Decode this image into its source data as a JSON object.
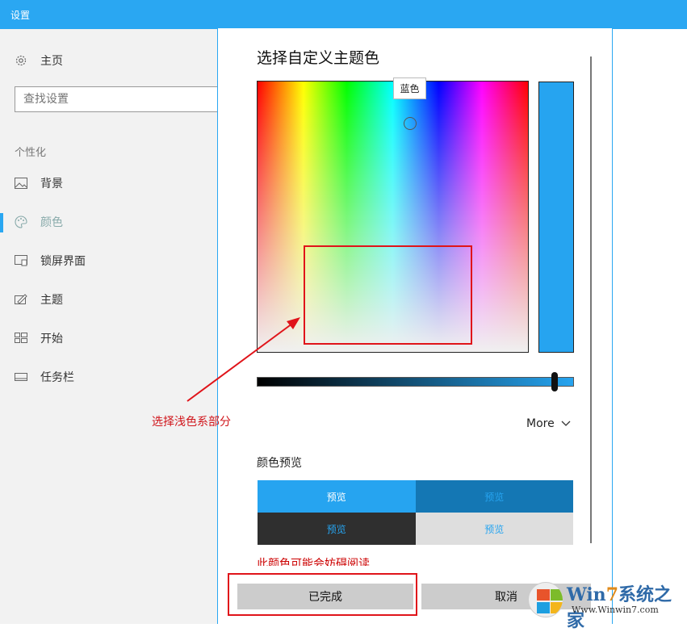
{
  "window": {
    "title": "设置"
  },
  "sidebar": {
    "home": "主页",
    "search_placeholder": "查找设置",
    "section": "个性化",
    "items": [
      {
        "label": "背景",
        "icon": "picture-icon"
      },
      {
        "label": "颜色",
        "icon": "palette-icon",
        "active": true
      },
      {
        "label": "锁屏界面",
        "icon": "lockscreen-icon"
      },
      {
        "label": "主题",
        "icon": "theme-icon"
      },
      {
        "label": "开始",
        "icon": "start-icon"
      },
      {
        "label": "任务栏",
        "icon": "taskbar-icon"
      }
    ]
  },
  "dialog": {
    "title": "选择自定义主题色",
    "tooltip": "蓝色",
    "selected_color": "#26a4f0",
    "more_label": "More",
    "preview_label": "颜色预览",
    "preview_cells": [
      "预览",
      "预览",
      "预览",
      "预览"
    ],
    "preview_colors": [
      "#26a4f0",
      "#1477b4",
      "#2f2f2f",
      "#dedede"
    ],
    "warning": "此颜色可能会妨碍阅读",
    "done_button": "已完成",
    "cancel_button": "取消"
  },
  "annotation": {
    "text": "选择浅色系部分"
  },
  "watermark": {
    "brand_a": "Win",
    "brand_b": "7",
    "brand_c": "系统之家",
    "url": "Www.Winwin7.com"
  }
}
